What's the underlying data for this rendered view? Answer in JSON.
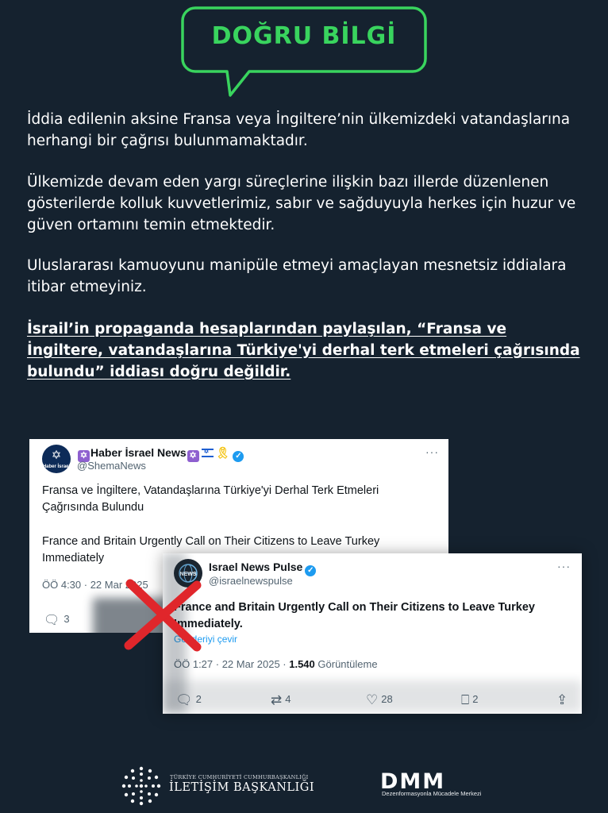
{
  "badge": {
    "title": "DOĞRU BİLGİ",
    "color": "#39d45e"
  },
  "paragraphs": {
    "p1": "İddia edilenin aksine Fransa veya İngiltere’nin ülkemizdeki vatandaşlarına herhangi bir çağrısı bulunmamaktadır.",
    "p2": "Ülkemizde devam eden yargı süreçlerine ilişkin bazı illerde düzenlenen gösterilerde kolluk kuvvetlerimiz, sabır ve sağduyuyla herkes için huzur ve güven ortamını temin etmektedir.",
    "p3": "Uluslararası kamuoyunu manipüle etmeyi amaçlayan mesnetsiz iddialara itibar etmeyiniz.",
    "p4": "İsrail’in propaganda hesaplarından paylaşılan, “Fransa ve İngiltere, vatandaşlarına Türkiye'yi derhal terk etmeleri çağrısında bulundu” iddiası doğru değildir."
  },
  "tweet1": {
    "name": "Haber İsrael News",
    "handle": "@ShemaNews",
    "avatar_label": "Haber İsrael",
    "text_tr": "Fransa ve İngiltere, Vatandaşlarına Türkiye'yi Derhal Terk Etmeleri Çağrısında Bulundu",
    "text_en": "France and Britain Urgently Call on Their Citizens to Leave Turkey Immediately",
    "meta": "ÖÖ 4:30 · 22 Mar 2025",
    "replies": "3",
    "more": "···"
  },
  "tweet2": {
    "name": "Israel News Pulse",
    "handle": "@israelnewspulse",
    "avatar_label": "NEWS",
    "text": "France and Britain Urgently Call on Their Citizens to Leave Turkey Immediately.",
    "translate": "Gönderiyi çevir",
    "time": "ÖÖ 1:27 · 22 Mar 2025 · ",
    "views": "1.540",
    "views_label": " Görüntüleme",
    "replies": "2",
    "reposts": "4",
    "likes": "28",
    "bookmarks": "2",
    "more": "···"
  },
  "cross_color": "#e0262b",
  "footer": {
    "org_small": "TÜRKİYE CUMHURİYETİ CUMHURBAŞKANLIĞI",
    "org_big": "İLETİŞİM BAŞKANLIĞI",
    "dmm": "DMM",
    "dmm_sub": "Dezenformasyonla Mücadele Merkezi"
  }
}
